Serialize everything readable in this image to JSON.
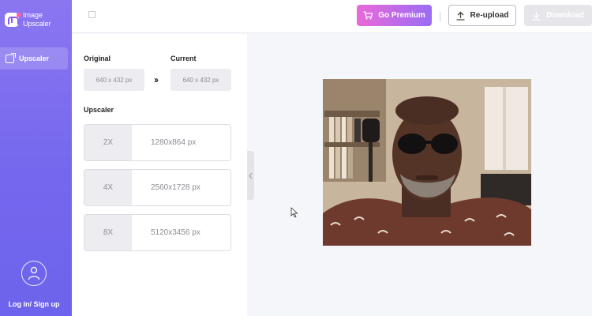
{
  "app": {
    "name_line1": "Image",
    "name_line2": "Upscaler"
  },
  "sidebar": {
    "items": [
      {
        "label": "Upscaler",
        "icon": "upscale-icon"
      }
    ],
    "login_label": "Log in/ Sign up"
  },
  "header": {
    "premium_label": "Go Premium",
    "reupload_label": "Re-upload",
    "download_label": "Download",
    "premium_colors": [
      "#e96ad8",
      "#9a6cf4"
    ],
    "download_disabled": true
  },
  "panel": {
    "original_label": "Original",
    "original_value": "640 x 432 px",
    "current_label": "Current",
    "current_value": "640 x 432 px",
    "upscaler_label": "Upscaler",
    "options": [
      {
        "factor": "2X",
        "resolution": "1280x864 px"
      },
      {
        "factor": "4X",
        "resolution": "2560x1728 px"
      },
      {
        "factor": "8X",
        "resolution": "5120x3456 px"
      }
    ]
  },
  "colors": {
    "sidebar": "#7468ee",
    "accent_pink": "#e96ad8",
    "accent_purple": "#9a6cf4"
  }
}
